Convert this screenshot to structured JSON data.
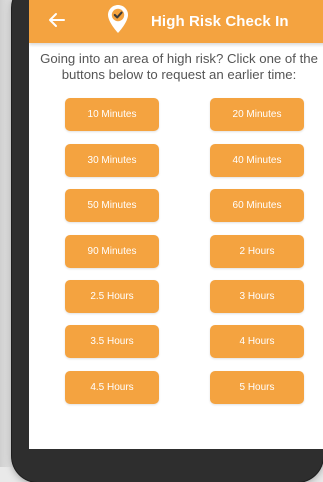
{
  "colors": {
    "accent": "#f4a340",
    "text": "#555555",
    "button_text": "#ffffff",
    "background": "#ffffff"
  },
  "header": {
    "title": "High Risk Check In",
    "back_icon": "arrow-left-icon",
    "logo_icon": "location-pin-check-icon"
  },
  "instructions": {
    "line1": "Going into an area of high risk? Click one of the",
    "line2": "buttons below to request an earlier time:"
  },
  "buttons": {
    "left": [
      "10 Minutes",
      "30 Minutes",
      "50 Minutes",
      "90 Minutes",
      "2.5 Hours",
      "3.5 Hours",
      "4.5 Hours"
    ],
    "right": [
      "20 Minutes",
      "40 Minutes",
      "60 Minutes",
      "2 Hours",
      "3 Hours",
      "4 Hours",
      "5 Hours"
    ]
  }
}
